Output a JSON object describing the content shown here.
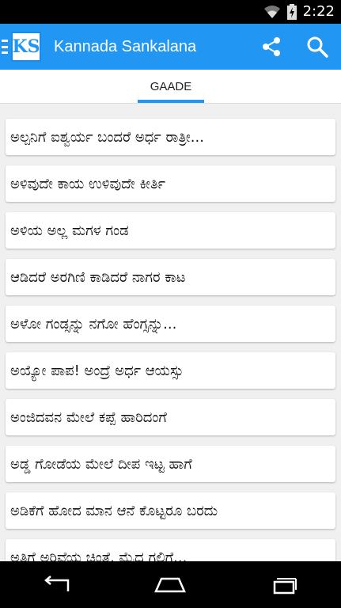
{
  "status_bar": {
    "time": "2:22",
    "wifi_icon": "wifi-icon",
    "battery_icon": "battery-charging-icon"
  },
  "app_bar": {
    "logo_text": "KS",
    "title": "Kannada Sankalana",
    "share_icon": "share-icon",
    "search_icon": "search-icon",
    "menu_icon": "menu-icon"
  },
  "tabs": [
    {
      "label": "GAADE",
      "selected": true
    }
  ],
  "items": [
    "ಅಲ್ಪನಿಗೆ ಐಶ್ವರ್ಯ ಬಂದರೆ ಅರ್ಧ ರಾತ್ರೀ...",
    "ಅಳಿವುದೇ ಕಾಯ ಉಳಿವುದೇ ಕೀರ್ತಿ",
    "ಅಳಿಯ ಅಲ್ಲ ಮಗಳ ಗಂಡ",
    "ಆಡಿದರೆ ಅರಗಿಣಿ ಕಾಡಿದರೆ ನಾಗರ ಕಾಟ",
    "ಅಳೋ ಗಂಡ್ಸನ್ನು ನಗೋ ಹೆಂಗ್ಸನ್ನು...",
    "ಅಯ್ಯೋ ಪಾಪ! ಅಂದ್ರೆ ಅರ್ಧ ಆಯಸ್ಸು",
    "ಅಂಜಿದವನ ಮೇಲೆ ಕಪ್ಪೆ ಹಾರಿದಂಗೆ",
    "ಅಡ್ಡ ಗೋಡೆಯ ಮೇಲೆ ದೀಪ ಇಟ್ಟ ಹಾಗೆ",
    "ಅಡಿಕೆಗೆ ಹೋದ ಮಾನ ಆನೆ ಕೊಟ್ಟರೂ ಬರದು",
    "ಅತಿಗೆ ಅರಿವೆಯ ಚಿಂತೆ, ಮೈದ ಗಲಿಗೆ..."
  ],
  "nav_bar": {
    "back_icon": "back-icon",
    "home_icon": "home-icon",
    "recents_icon": "recents-icon"
  }
}
